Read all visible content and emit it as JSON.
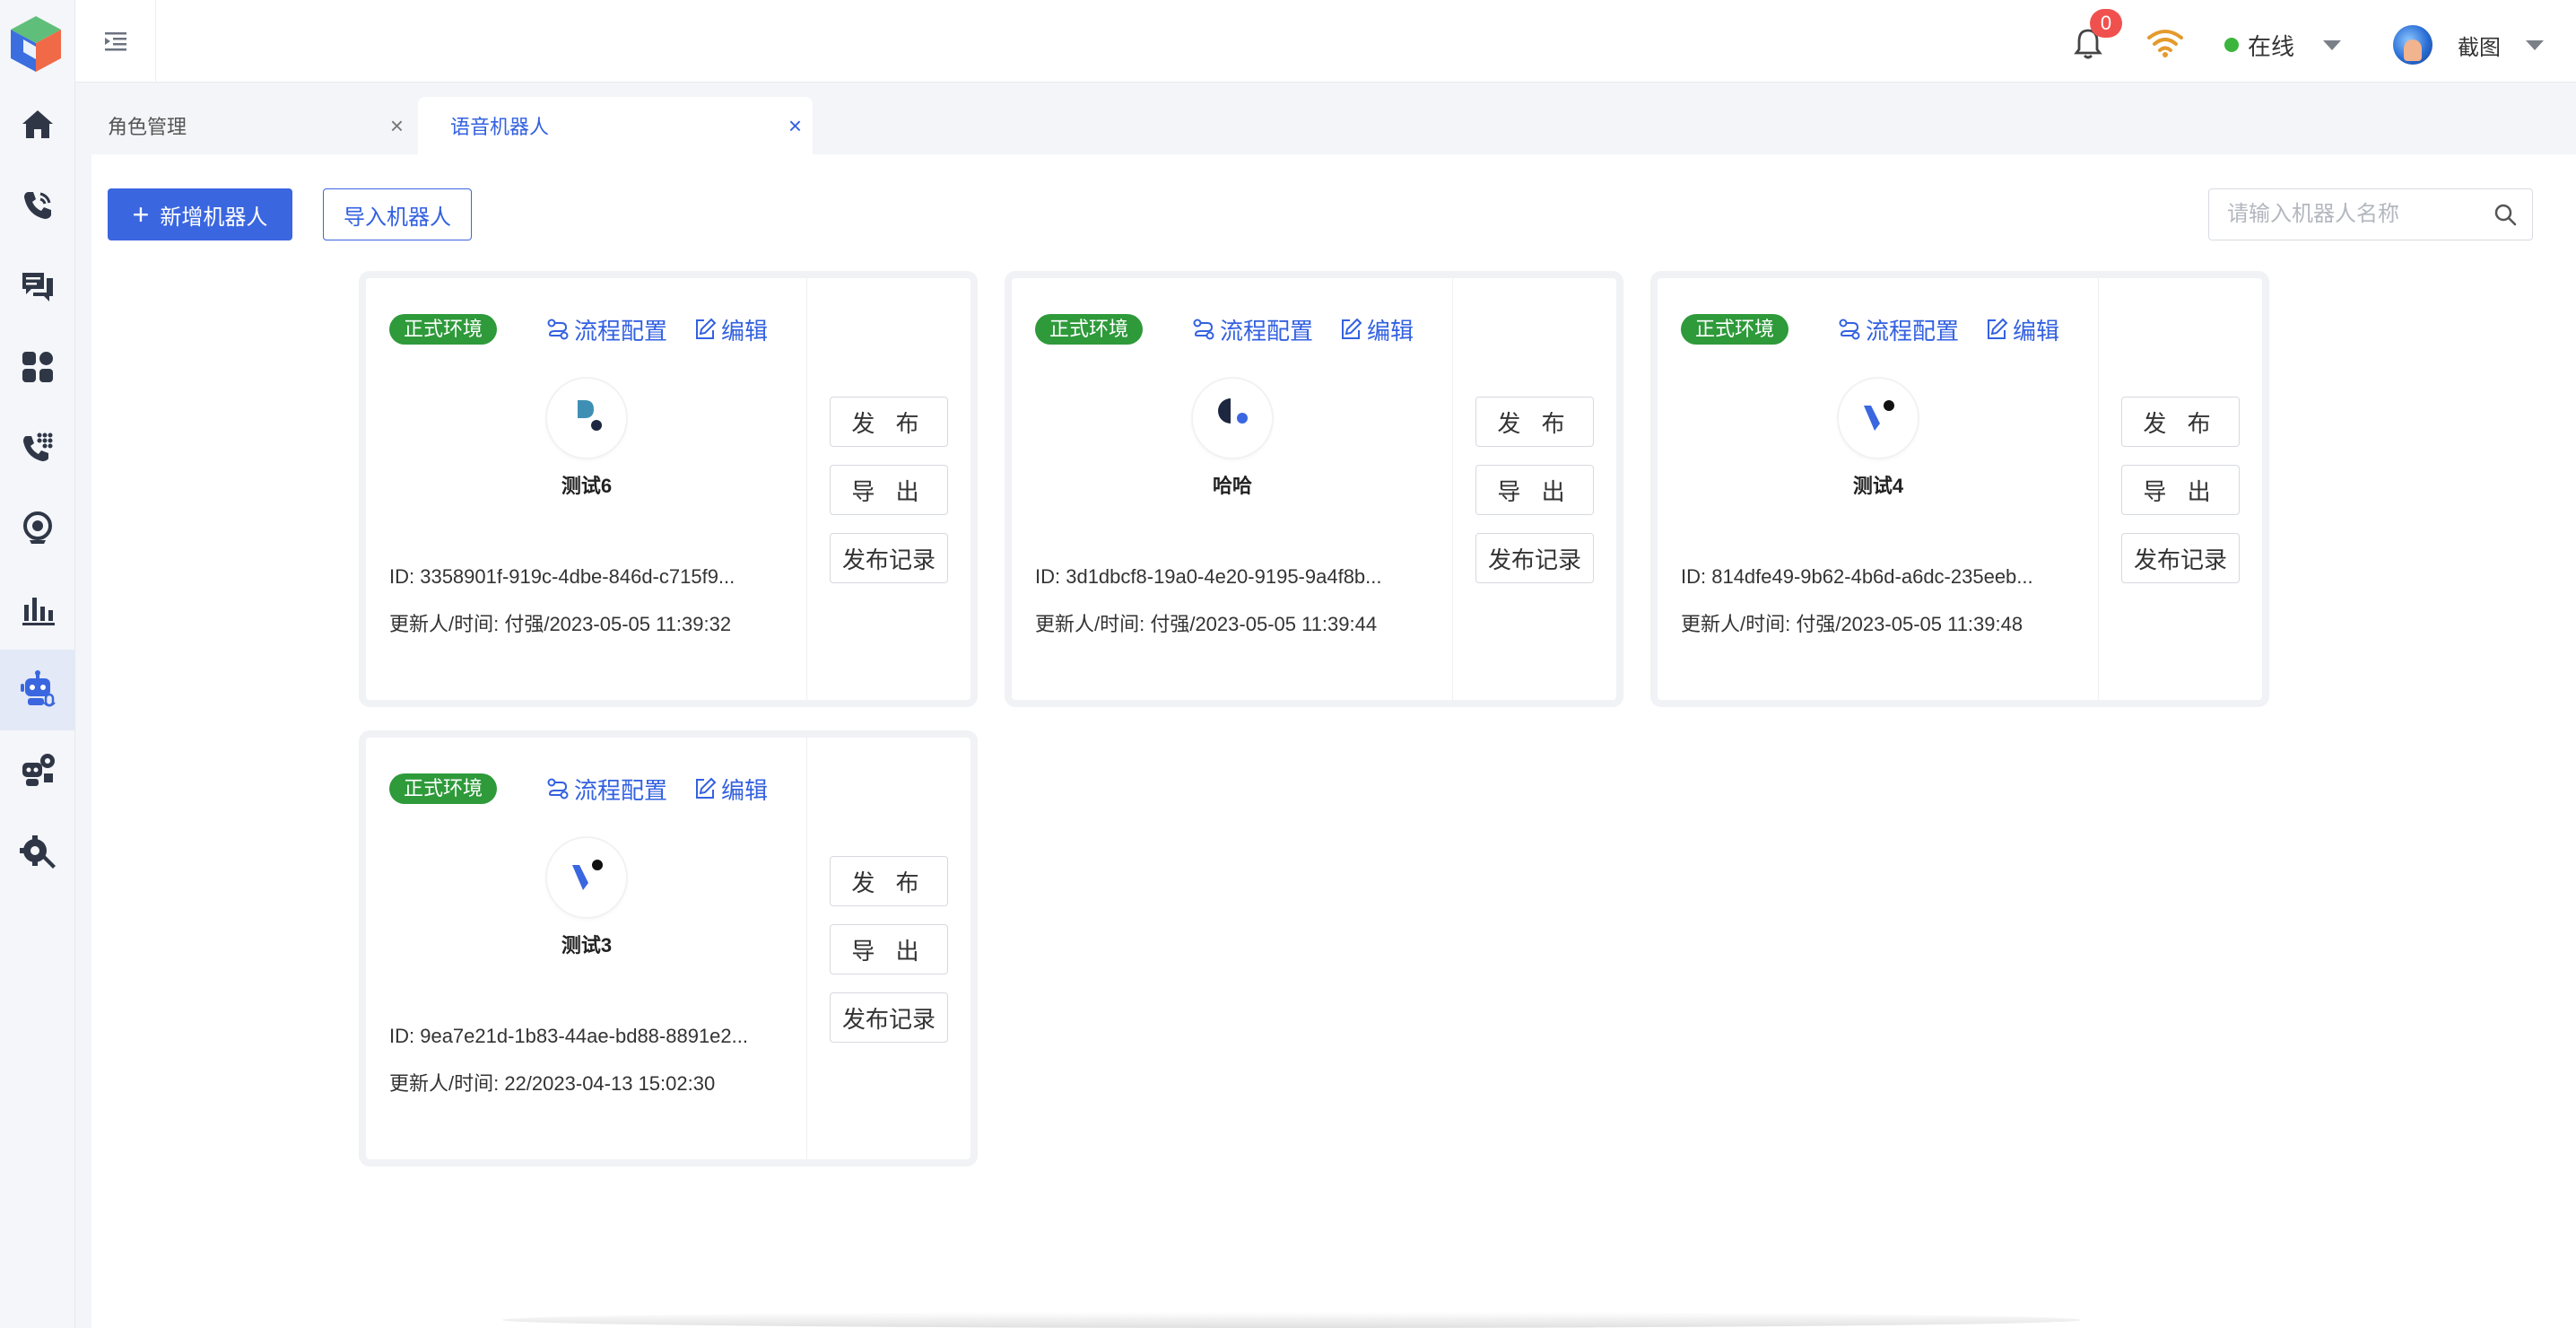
{
  "sidebar": {
    "items": [
      {
        "icon": "home-icon"
      },
      {
        "icon": "phone-call-icon"
      },
      {
        "icon": "chat-icon"
      },
      {
        "icon": "apps-icon"
      },
      {
        "icon": "phone-keypad-icon"
      },
      {
        "icon": "webcam-icon"
      },
      {
        "icon": "bar-chart-icon"
      },
      {
        "icon": "voice-robot-icon",
        "active": true
      },
      {
        "icon": "robot-settings-icon"
      },
      {
        "icon": "tools-settings-icon"
      }
    ]
  },
  "header": {
    "notification_count": "0",
    "status": "在线",
    "username": "截图"
  },
  "tabs": [
    {
      "label": "角色管理"
    },
    {
      "label": "语音机器人",
      "active": true
    }
  ],
  "toolbar": {
    "add_label": "新增机器人",
    "import_label": "导入机器人",
    "search_placeholder": "请输入机器人名称"
  },
  "colors": {
    "primary": "#3a66e0",
    "env_tag": "#2e9a3a",
    "badge": "#f0514f"
  },
  "robots": [
    {
      "env": "正式环境",
      "flow_label": "流程配置",
      "edit_label": "编辑",
      "avatar_icon": "logo-d-icon",
      "name": "测试6",
      "id": "ID: 3358901f-919c-4dbe-846d-c715f9...",
      "updated": "更新人/时间: 付强/2023-05-05 11:39:32",
      "publish": "发 布",
      "export": "导 出",
      "records": "发布记录"
    },
    {
      "env": "正式环境",
      "flow_label": "流程配置",
      "edit_label": "编辑",
      "avatar_icon": "logo-half-circle-icon",
      "name": "哈哈",
      "id": "ID: 3d1dbcf8-19a0-4e20-9195-9a4f8b...",
      "updated": "更新人/时间: 付强/2023-05-05 11:39:44",
      "publish": "发 布",
      "export": "导 出",
      "records": "发布记录"
    },
    {
      "env": "正式环境",
      "flow_label": "流程配置",
      "edit_label": "编辑",
      "avatar_icon": "logo-v-icon",
      "name": "测试4",
      "id": "ID: 814dfe49-9b62-4b6d-a6dc-235eeb...",
      "updated": "更新人/时间: 付强/2023-05-05 11:39:48",
      "publish": "发 布",
      "export": "导 出",
      "records": "发布记录"
    },
    {
      "env": "正式环境",
      "flow_label": "流程配置",
      "edit_label": "编辑",
      "avatar_icon": "logo-v-icon",
      "name": "测试3",
      "id": "ID: 9ea7e21d-1b83-44ae-bd88-8891e2...",
      "updated": "更新人/时间: 22/2023-04-13 15:02:30",
      "publish": "发 布",
      "export": "导 出",
      "records": "发布记录"
    }
  ]
}
